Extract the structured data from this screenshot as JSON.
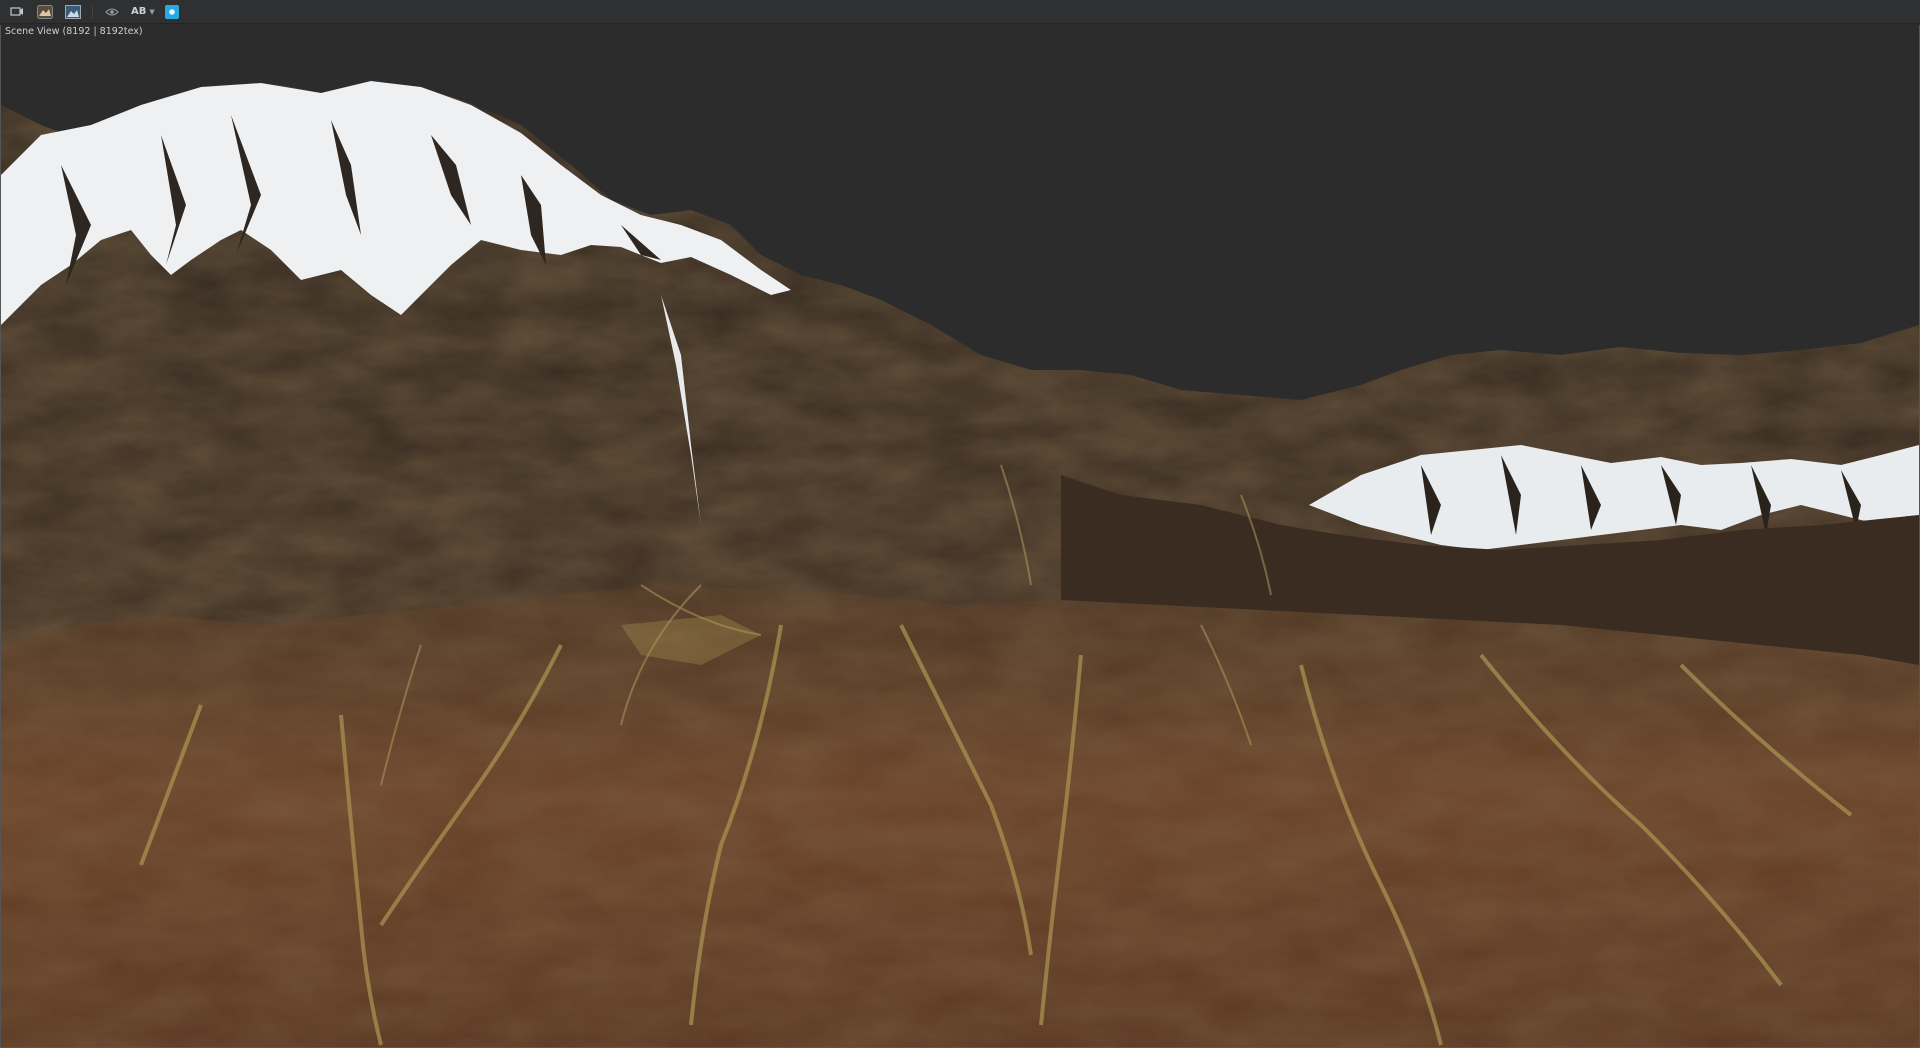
{
  "toolbar": {
    "items": [
      {
        "name": "scene-tools-icon"
      },
      {
        "name": "terrain-preview-icon"
      },
      {
        "name": "image-preview-icon"
      },
      {
        "name": "eye-icon"
      }
    ],
    "ab_label": "AB",
    "active_icon": "render-icon",
    "accent": "#2aa8e0"
  },
  "viewport": {
    "label": "Scene View (8192 | 8192tex)",
    "background": "#2c2c2c"
  },
  "terrain": {
    "snow_color": "#eef0f2",
    "rock_color": "#3a2a1c",
    "soil_color": "#6b4326",
    "channel_color": "#a89150"
  }
}
